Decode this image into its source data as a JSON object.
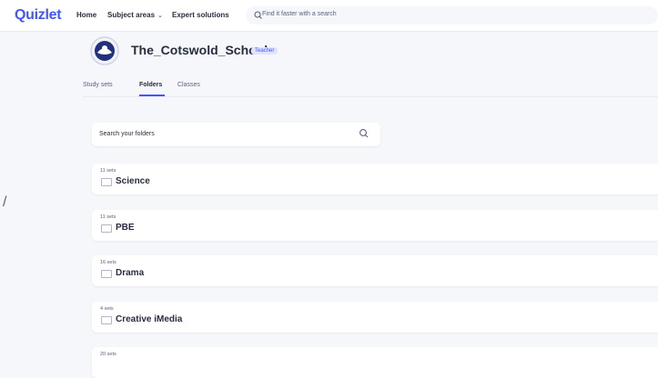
{
  "header": {
    "logo": "Quizlet",
    "nav": {
      "home": "Home",
      "subject_areas": "Subject areas",
      "expert_solutions": "Expert solutions"
    },
    "search_placeholder": "Find it faster with a search"
  },
  "profile": {
    "username": "The_Cotswold_School",
    "badge": "Teacher"
  },
  "tabs": {
    "study_sets": "Study sets",
    "folders": "Folders",
    "classes": "Classes"
  },
  "folder_search_placeholder": "Search your folders",
  "folders": [
    {
      "count": "11 sets",
      "title": "Science"
    },
    {
      "count": "11 sets",
      "title": "PBE"
    },
    {
      "count": "16 sets",
      "title": "Drama"
    },
    {
      "count": "4 sets",
      "title": "Creative iMedia"
    },
    {
      "count": "20 sets",
      "title": ""
    }
  ],
  "side_mark": "/",
  "colors": {
    "accent": "#4255ff",
    "background": "#f6f7fb",
    "text": "#282e3e",
    "muted": "#586380"
  }
}
